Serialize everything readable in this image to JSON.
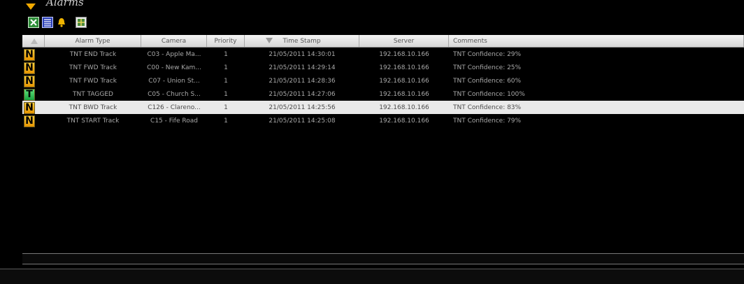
{
  "window": {
    "title": "Alarms"
  },
  "toolbar": {
    "buttons": [
      {
        "icon": "excel-export-icon"
      },
      {
        "icon": "list-view-icon"
      },
      {
        "icon": "bell-icon"
      },
      {
        "icon": "map-icon"
      }
    ]
  },
  "table": {
    "columns": [
      "Alarm Type",
      "Camera",
      "Priority",
      "Time Stamp",
      "Server",
      "Comments"
    ],
    "sorted_column": "Time Stamp",
    "rows": [
      {
        "badge": "N",
        "alarm_type": "TNT END Track",
        "camera": "C03 - Apple Ma...",
        "priority": "1",
        "timestamp": "21/05/2011 14:30:01",
        "server": "192.168.10.166",
        "comments": "TNT Confidence: 29%",
        "selected": false
      },
      {
        "badge": "N",
        "alarm_type": "TNT FWD Track",
        "camera": "C00 - New Kam...",
        "priority": "1",
        "timestamp": "21/05/2011 14:29:14",
        "server": "192.168.10.166",
        "comments": "TNT Confidence: 25%",
        "selected": false
      },
      {
        "badge": "N",
        "alarm_type": "TNT FWD Track",
        "camera": "C07 - Union St...",
        "priority": "1",
        "timestamp": "21/05/2011 14:28:36",
        "server": "192.168.10.166",
        "comments": "TNT Confidence: 60%",
        "selected": false
      },
      {
        "badge": "T",
        "alarm_type": "TNT TAGGED",
        "camera": "C05 - Church S...",
        "priority": "1",
        "timestamp": "21/05/2011 14:27:06",
        "server": "192.168.10.166",
        "comments": "TNT Confidence: 100%",
        "selected": false
      },
      {
        "badge": "N",
        "alarm_type": "TNT BWD Track",
        "camera": "C126 - Clareno...",
        "priority": "1",
        "timestamp": "21/05/2011 14:25:56",
        "server": "192.168.10.166",
        "comments": "TNT Confidence: 83%",
        "selected": true
      },
      {
        "badge": "N",
        "alarm_type": "TNT START Track",
        "camera": "C15 - Fife Road",
        "priority": "1",
        "timestamp": "21/05/2011 14:25:08",
        "server": "192.168.10.166",
        "comments": "TNT Confidence: 79%",
        "selected": false
      }
    ]
  },
  "colors": {
    "background": "#000000",
    "badge_n": "#f5b800",
    "badge_t": "#2ec24f",
    "selected_row": "#e9e9e9"
  }
}
